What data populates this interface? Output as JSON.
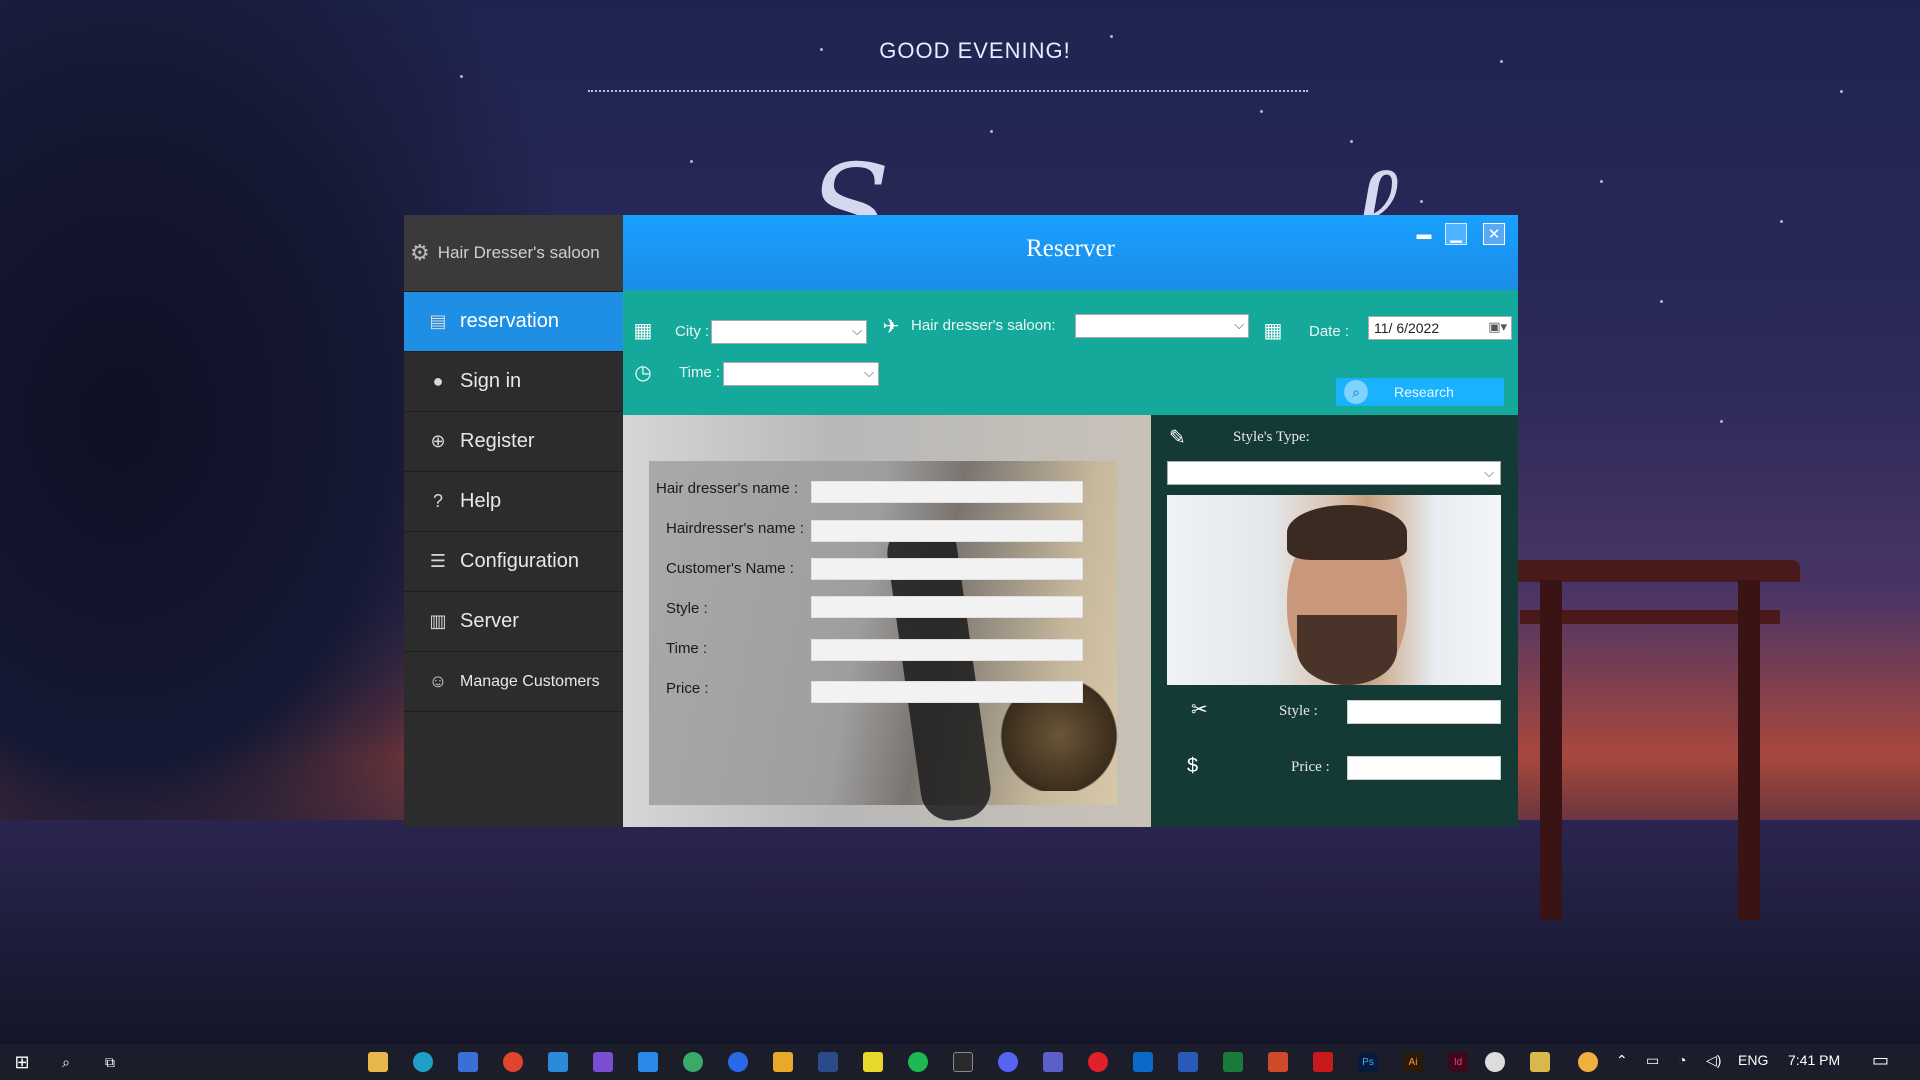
{
  "desktop": {
    "greeting": "GOOD EVENING!"
  },
  "sidebar": {
    "brand": "Hair Dresser's saloon",
    "items": [
      {
        "label": "reservation",
        "icon": "reservation-icon"
      },
      {
        "label": "Sign in",
        "icon": "user-icon"
      },
      {
        "label": "Register",
        "icon": "plus-circle-icon"
      },
      {
        "label": "Help",
        "icon": "help-icon"
      },
      {
        "label": "Configuration",
        "icon": "sliders-icon"
      },
      {
        "label": "Server",
        "icon": "server-icon"
      },
      {
        "label": "Manage Customers",
        "icon": "customers-icon"
      }
    ]
  },
  "window": {
    "title": "Reserver"
  },
  "filters": {
    "city_label": "City :",
    "saloon_label": "Hair dresser's saloon:",
    "date_label": "Date :",
    "date_value": "11/ 6/2022",
    "time_label": "Time :",
    "search_label": "Research"
  },
  "form": {
    "fields": [
      {
        "label": "Hair dresser's name :"
      },
      {
        "label": "Hairdresser's name :"
      },
      {
        "label": "Customer's Name :"
      },
      {
        "label": "Style :"
      },
      {
        "label": "Time :"
      },
      {
        "label": "Price :"
      }
    ]
  },
  "style_panel": {
    "type_label": "Style's Type:",
    "style_label": "Style :",
    "price_label": "Price :"
  },
  "taskbar": {
    "language": "ENG",
    "clock": "7:41 PM"
  },
  "colors": {
    "accent_blue": "#1f8fe5",
    "title_blue": "#1aa0ff",
    "teal": "#14a99a",
    "dark_teal": "#143a36",
    "sidebar": "#2c2c2c"
  }
}
